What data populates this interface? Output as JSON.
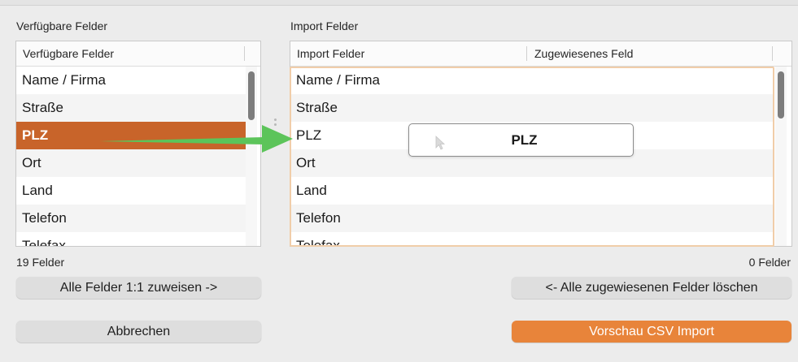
{
  "available_panel": {
    "section_label": "Verfügbare Felder",
    "header": "Verfügbare Felder",
    "rows": [
      "Name / Firma",
      "Straße",
      "PLZ",
      "Ort",
      "Land",
      "Telefon",
      "Telefax"
    ],
    "selected_row": "PLZ",
    "count": "19 Felder",
    "assign_all_button": "Alle Felder 1:1 zuweisen ->",
    "cancel_button": "Abbrechen"
  },
  "import_panel": {
    "section_label": "Import Felder",
    "header_col1": "Import Felder",
    "header_col2": "Zugewiesenes Feld",
    "rows": [
      "Name / Firma",
      "Straße",
      "PLZ",
      "Ort",
      "Land",
      "Telefon",
      "Telefax"
    ],
    "count": "0 Felder",
    "clear_button": "<- Alle zugewiesenen Felder löschen",
    "preview_button": "Vorschau CSV Import"
  },
  "drag": {
    "label": "PLZ",
    "arrow_color": "#5cc45a",
    "icons": [
      "arrow-pointer-icon",
      "drag-arrow-icon"
    ]
  },
  "colors": {
    "selection": "#c8642a",
    "primary_button": "#e8843a",
    "focus_ring": "#f0cda9"
  }
}
